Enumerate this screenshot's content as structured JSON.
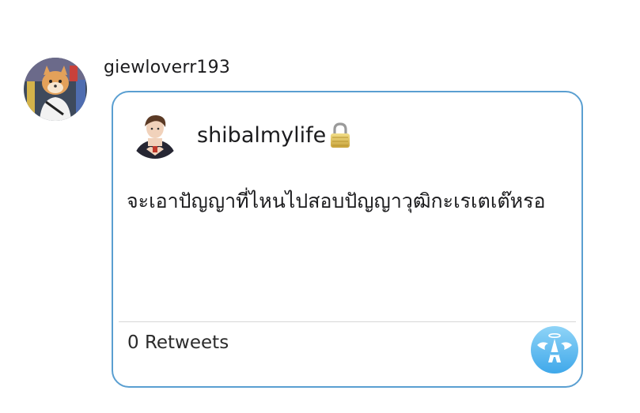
{
  "outer": {
    "username": "giewloverr193"
  },
  "card": {
    "username": "shibalmylife",
    "post_text": "จะเอาปัญญาที่ไหนไปสอบปัญญาวุฒิกะเรเตเต๊หรอ",
    "retweets_label": "0 Retweets"
  },
  "icons": {
    "lock": "lock-icon",
    "app": "angel-a-app-icon"
  },
  "colors": {
    "card_border": "#5a9fd1",
    "app_icon_top": "#8fd4f7",
    "app_icon_bottom": "#3fa8ea"
  }
}
